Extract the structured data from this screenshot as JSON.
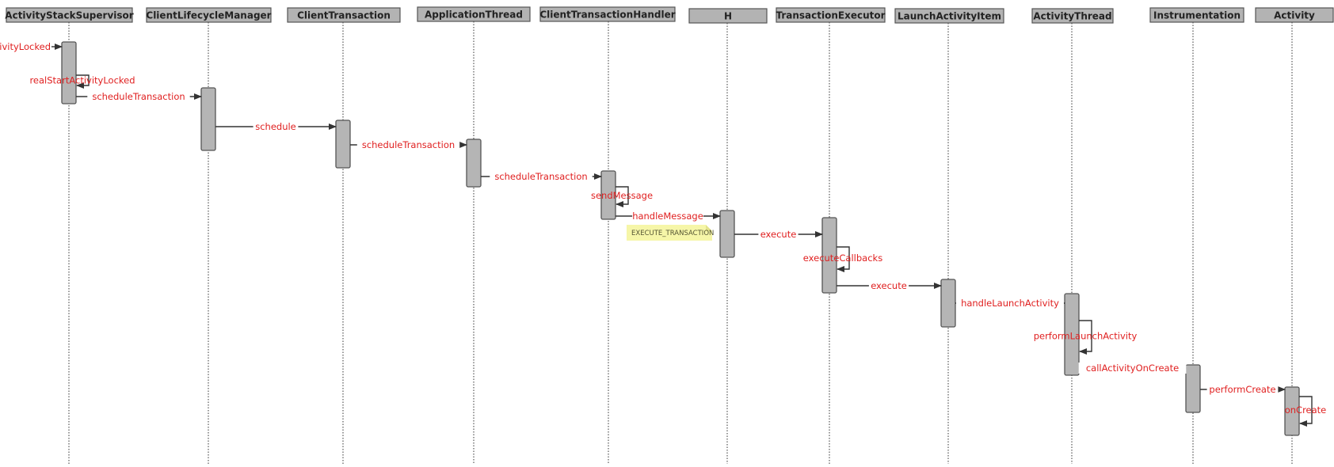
{
  "diagram": {
    "type": "uml-sequence-diagram",
    "participants": [
      {
        "id": "ass",
        "label": "ActivityStackSupervisor"
      },
      {
        "id": "clm",
        "label": "ClientLifecycleManager"
      },
      {
        "id": "ct",
        "label": "ClientTransaction"
      },
      {
        "id": "at",
        "label": "ApplicationThread"
      },
      {
        "id": "cth",
        "label": "ClientTransactionHandler"
      },
      {
        "id": "h",
        "label": "H"
      },
      {
        "id": "te",
        "label": "TransactionExecutor"
      },
      {
        "id": "lai",
        "label": "LaunchActivityItem"
      },
      {
        "id": "athr",
        "label": "ActivityThread"
      },
      {
        "id": "instr",
        "label": "Instrumentation"
      },
      {
        "id": "act",
        "label": "Activity"
      }
    ],
    "messages": [
      {
        "from": null,
        "to": "ass",
        "label": "startSpecificActivityLocked",
        "visible_label": "tivityLocked",
        "type": "incoming"
      },
      {
        "from": "ass",
        "to": "ass",
        "label": "realStartActivityLocked",
        "type": "self"
      },
      {
        "from": "ass",
        "to": "clm",
        "label": "scheduleTransaction",
        "type": "call"
      },
      {
        "from": "clm",
        "to": "ct",
        "label": "schedule",
        "type": "call"
      },
      {
        "from": "ct",
        "to": "at",
        "label": "scheduleTransaction",
        "type": "call"
      },
      {
        "from": "at",
        "to": "cth",
        "label": "scheduleTransaction",
        "type": "call"
      },
      {
        "from": "cth",
        "to": "cth",
        "label": "sendMessage",
        "type": "self"
      },
      {
        "from": "cth",
        "to": "h",
        "label": "handleMessage",
        "type": "call"
      },
      {
        "from": "h",
        "to": "te",
        "label": "execute",
        "type": "call"
      },
      {
        "from": "te",
        "to": "te",
        "label": "executeCallbacks",
        "type": "self"
      },
      {
        "from": "te",
        "to": "lai",
        "label": "execute",
        "type": "call"
      },
      {
        "from": "lai",
        "to": "athr",
        "label": "handleLaunchActivity",
        "type": "call"
      },
      {
        "from": "athr",
        "to": "athr",
        "label": "performLaunchActivity",
        "type": "self"
      },
      {
        "from": "athr",
        "to": "instr",
        "label": "callActivityOnCreate",
        "type": "call"
      },
      {
        "from": "instr",
        "to": "act",
        "label": "performCreate",
        "type": "call"
      },
      {
        "from": "act",
        "to": "act",
        "label": "onCreate",
        "type": "self"
      }
    ],
    "notes": [
      {
        "attached_to": "handleMessage",
        "text": "EXECUTE_TRANSACTION"
      }
    ],
    "colors": {
      "header_fill": "#b3b3b3",
      "activation_fill": "#b5b5b5",
      "message_label": "#e02020",
      "note_fill": "#f6f6a8"
    }
  }
}
